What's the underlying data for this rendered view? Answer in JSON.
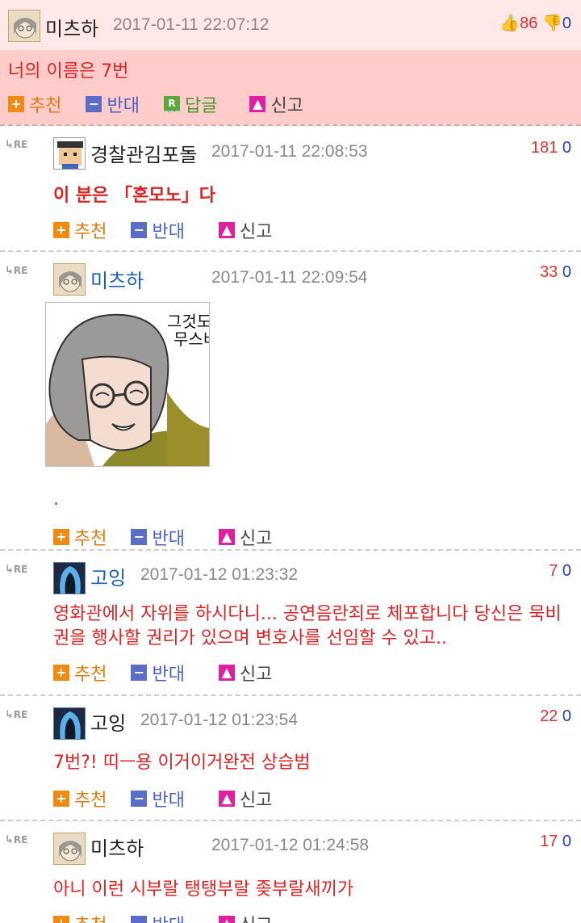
{
  "top_comment": {
    "nickname": "미츠하",
    "date": "2017-01-11 22:07:12",
    "up": "86",
    "down": "0",
    "text": "너의 이름은 7번",
    "actions": {
      "up": "추천",
      "down": "반대",
      "reply": "답글",
      "report": "신고"
    }
  },
  "re_label": "RE",
  "replies": [
    {
      "nickname": "경찰관김포돌",
      "nick_color": "#222",
      "date": "2017-01-11 22:08:53",
      "up": "181",
      "down": "0",
      "text": "이 분은 「혼모노」다",
      "bold": true
    },
    {
      "nickname": "미츠하",
      "nick_color": "#222",
      "date": "2017-01-11 22:09:54",
      "up": "33",
      "down": "0",
      "image_text_1": "그것도",
      "image_text_2": "무스비",
      "text": "."
    },
    {
      "nickname": "고잉",
      "nick_color": "#1a5fb4",
      "date": "2017-01-12 01:23:32",
      "up": "7",
      "down": "0",
      "text": "영화관에서 자위를 하시다니... 공연음란죄로 체포합니다 당신은 묵비권을 행사할 권리가 있으며 변호사를 선임할 수 있고.."
    },
    {
      "nickname": "고잉",
      "nick_color": "#1a5fb4",
      "date": "2017-01-12 01:23:54",
      "up": "22",
      "down": "0",
      "text": "7번?! 띠ㅡ용 이거이거완전 상습범"
    },
    {
      "nickname": "미츠하",
      "nick_color": "#222",
      "date": "2017-01-12 01:24:58",
      "up": "17",
      "down": "0",
      "text": "아니 이런 시부랄 탱탱부랄 좆부랄새끼가"
    }
  ],
  "actions": {
    "up": "추천",
    "down": "반대",
    "report": "신고"
  },
  "colors": {
    "top_bg": "#ffcccc",
    "text_red": "#dd2222",
    "up": "#e03030",
    "down": "#2040c0"
  }
}
